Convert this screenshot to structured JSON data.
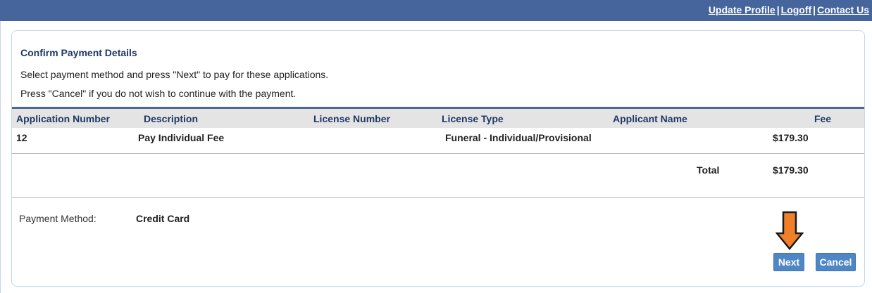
{
  "header": {
    "links": [
      "Update Profile",
      "Logoff",
      "Contact Us"
    ],
    "separator": "|"
  },
  "panel": {
    "title": "Confirm Payment Details",
    "instructions": [
      "Select payment method and press \"Next\" to pay for these applications.",
      "Press \"Cancel\" if you do not wish to continue with the payment."
    ]
  },
  "table": {
    "columns": [
      "Application Number",
      "Description",
      "License Number",
      "License Type",
      "Applicant Name",
      "Fee"
    ],
    "rows": [
      [
        "12",
        "Pay Individual Fee",
        "",
        "Funeral - Individual/Provisional",
        "",
        "$179.30"
      ]
    ],
    "total_label": "Total",
    "total_value": "$179.30"
  },
  "payment": {
    "label": "Payment Method:",
    "value": "Credit Card"
  },
  "buttons": {
    "next": "Next",
    "cancel": "Cancel"
  },
  "colors": {
    "header_bar": "#47659d",
    "title": "#1f3864",
    "button": "#4f87c6",
    "arrow": "#f07f2a"
  },
  "icons": {
    "pointer": "down-arrow-icon"
  }
}
